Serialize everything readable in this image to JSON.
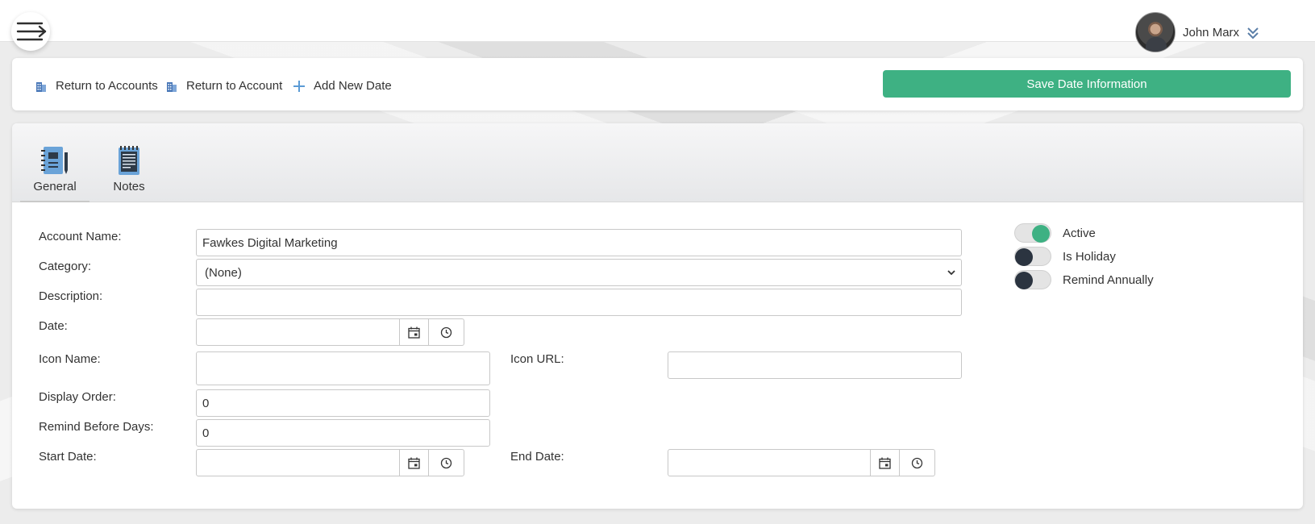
{
  "header": {
    "user_name": "John Marx",
    "icons": {
      "menu": "hamburger-menu-icon",
      "user_dropdown": "double-chevron-down-icon"
    }
  },
  "toolbar": {
    "return_accounts": "Return to Accounts",
    "return_account": "Return to Account",
    "add_new_date": "Add New Date",
    "save_label": "Save Date Information"
  },
  "tabs": [
    {
      "label": "General",
      "active": true,
      "icon": "notebook-pen-icon"
    },
    {
      "label": "Notes",
      "active": false,
      "icon": "notepad-icon"
    }
  ],
  "form": {
    "account_name": {
      "label": "Account Name:",
      "value": "Fawkes Digital Marketing"
    },
    "category": {
      "label": "Category:",
      "value": "(None)"
    },
    "description": {
      "label": "Description:",
      "value": ""
    },
    "date": {
      "label": "Date:",
      "value": ""
    },
    "icon_name": {
      "label": "Icon Name:",
      "value": ""
    },
    "icon_url": {
      "label": "Icon URL:",
      "value": ""
    },
    "display_order": {
      "label": "Display Order:",
      "value": "0"
    },
    "remind_before_days": {
      "label": "Remind Before Days:",
      "value": "0"
    },
    "start_date": {
      "label": "Start Date:",
      "value": ""
    },
    "end_date": {
      "label": "End Date:",
      "value": ""
    }
  },
  "toggles": [
    {
      "label": "Active",
      "on": true
    },
    {
      "label": "Is Holiday",
      "on": false
    },
    {
      "label": "Remind Annually",
      "on": false
    }
  ],
  "colors": {
    "accent": "#3eb183",
    "toggle_off_knob": "#2b3440",
    "icon_blue": "#5b9bd5"
  }
}
